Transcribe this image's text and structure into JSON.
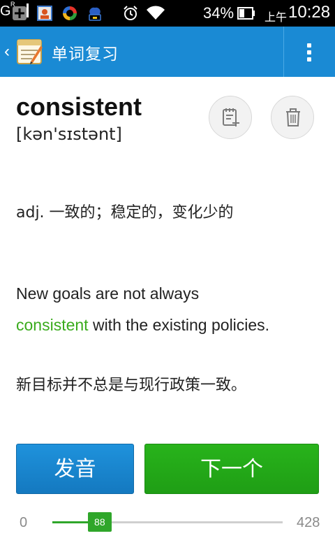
{
  "status_bar": {
    "battery_percent": "34%",
    "am_pm": "上午",
    "time": "10:28",
    "network_type": "G",
    "icons": [
      "add-square-icon",
      "contact-card-icon",
      "sync-app-icon",
      "cloud-notification-icon",
      "alarm-icon",
      "wifi-icon",
      "signal-icon",
      "battery-icon"
    ]
  },
  "app_bar": {
    "title": "单词复习",
    "back_glyph": "‹",
    "accent_color": "#1a8ad4"
  },
  "word_card": {
    "word": "consistent",
    "phonetic": "[kən'sɪstənt]",
    "definition": "adj. 一致的；稳定的，变化少的",
    "example_before": "New goals are not always ",
    "example_highlight": "consistent",
    "example_after": " with the existing policies.",
    "translation": "新目标并不总是与现行政策一致。",
    "highlight_color": "#3aab1d"
  },
  "actions": {
    "pronounce_label": "发音",
    "next_label": "下一个"
  },
  "progress": {
    "min": "0",
    "max": "428",
    "current": "88",
    "fraction": 0.2056
  }
}
